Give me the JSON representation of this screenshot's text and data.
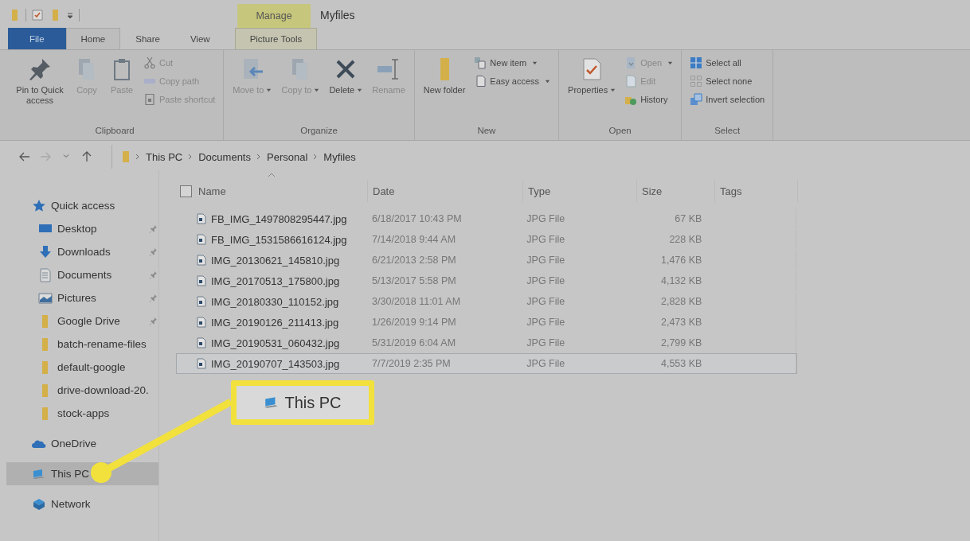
{
  "title_bar": {
    "contextual_tab": "Manage",
    "title": "Myfiles"
  },
  "ribbon_tabs": [
    {
      "label": "File",
      "kind": "file",
      "selected": false
    },
    {
      "label": "Home",
      "kind": "tab",
      "selected": true
    },
    {
      "label": "Share",
      "kind": "tab",
      "selected": false
    },
    {
      "label": "View",
      "kind": "tab",
      "selected": false
    },
    {
      "label": "Picture Tools",
      "kind": "contextual",
      "selected": false
    }
  ],
  "ribbon_groups": [
    {
      "label": "Clipboard",
      "large": [
        {
          "label": "Pin to Quick access",
          "disabled": false,
          "dropdown": false
        },
        {
          "label": "Copy",
          "disabled": true,
          "dropdown": false
        },
        {
          "label": "Paste",
          "disabled": true,
          "dropdown": false
        }
      ],
      "small": [
        {
          "label": "Cut",
          "disabled": true,
          "dropdown": false
        },
        {
          "label": "Copy path",
          "disabled": true,
          "dropdown": false
        },
        {
          "label": "Paste shortcut",
          "disabled": true,
          "dropdown": false
        }
      ]
    },
    {
      "label": "Organize",
      "large": [
        {
          "label": "Move to",
          "disabled": true,
          "dropdown": true
        },
        {
          "label": "Copy to",
          "disabled": true,
          "dropdown": true
        },
        {
          "label": "Delete",
          "disabled": false,
          "dropdown": true
        },
        {
          "label": "Rename",
          "disabled": true,
          "dropdown": false
        }
      ]
    },
    {
      "label": "New",
      "large": [
        {
          "label": "New folder",
          "disabled": false,
          "dropdown": false
        }
      ],
      "small": [
        {
          "label": "New item",
          "disabled": false,
          "dropdown": true
        },
        {
          "label": "Easy access",
          "disabled": false,
          "dropdown": true
        }
      ]
    },
    {
      "label": "Open",
      "large": [
        {
          "label": "Properties",
          "disabled": false,
          "dropdown": true
        }
      ],
      "small": [
        {
          "label": "Open",
          "disabled": true,
          "dropdown": true
        },
        {
          "label": "Edit",
          "disabled": true,
          "dropdown": false
        },
        {
          "label": "History",
          "disabled": false,
          "dropdown": false
        }
      ]
    },
    {
      "label": "Select",
      "small": [
        {
          "label": "Select all",
          "disabled": false,
          "dropdown": false
        },
        {
          "label": "Select none",
          "disabled": false,
          "dropdown": false
        },
        {
          "label": "Invert selection",
          "disabled": false,
          "dropdown": false
        }
      ]
    }
  ],
  "navigation": [
    {
      "disabled": false
    },
    {
      "disabled": true
    },
    {
      "disabled": false
    },
    {
      "disabled": false
    }
  ],
  "address_bar": {
    "path": [
      "This PC",
      "Documents",
      "Personal",
      "Myfiles"
    ]
  },
  "sidebar": {
    "items": [
      {
        "label": "Quick access",
        "selected": false,
        "children": [
          {
            "label": "Desktop",
            "pinned": true,
            "selected": false
          },
          {
            "label": "Downloads",
            "pinned": true,
            "selected": false
          },
          {
            "label": "Documents",
            "pinned": true,
            "selected": false
          },
          {
            "label": "Pictures",
            "pinned": true,
            "selected": false
          },
          {
            "label": "Google Drive",
            "pinned": true,
            "selected": false
          },
          {
            "label": "batch-rename-files",
            "pinned": false,
            "selected": false
          },
          {
            "label": "default-google",
            "pinned": false,
            "selected": false
          },
          {
            "label": "drive-download-20.",
            "pinned": false,
            "selected": false
          },
          {
            "label": "stock-apps",
            "pinned": false,
            "selected": false
          }
        ]
      },
      {
        "label": "OneDrive",
        "selected": false
      },
      {
        "label": "This PC",
        "selected": true
      },
      {
        "label": "Network",
        "selected": false
      }
    ]
  },
  "file_list": {
    "select_all_checked": false,
    "columns": [
      "Name",
      "Date",
      "Type",
      "Size",
      "Tags"
    ],
    "rows": [
      {
        "name": "FB_IMG_1497808295447.jpg",
        "date": "6/18/2017 10:43 PM",
        "type": "JPG File",
        "size": "67 KB",
        "selected": false
      },
      {
        "name": "FB_IMG_1531586616124.jpg",
        "date": "7/14/2018 9:44 AM",
        "type": "JPG File",
        "size": "228 KB",
        "selected": false
      },
      {
        "name": "IMG_20130621_145810.jpg",
        "date": "6/21/2013 2:58 PM",
        "type": "JPG File",
        "size": "1,476 KB",
        "selected": false
      },
      {
        "name": "IMG_20170513_175800.jpg",
        "date": "5/13/2017 5:58 PM",
        "type": "JPG File",
        "size": "4,132 KB",
        "selected": false
      },
      {
        "name": "IMG_20180330_110152.jpg",
        "date": "3/30/2018 11:01 AM",
        "type": "JPG File",
        "size": "2,828 KB",
        "selected": false
      },
      {
        "name": "IMG_20190126_211413.jpg",
        "date": "1/26/2019 9:14 PM",
        "type": "JPG File",
        "size": "2,473 KB",
        "selected": false
      },
      {
        "name": "IMG_20190531_060432.jpg",
        "date": "5/31/2019 6:04 AM",
        "type": "JPG File",
        "size": "2,799 KB",
        "selected": false
      },
      {
        "name": "IMG_20190707_143503.jpg",
        "date": "7/7/2019 2:35 PM",
        "type": "JPG File",
        "size": "4,553 KB",
        "selected": true
      }
    ]
  },
  "callout": {
    "label": "This PC"
  }
}
